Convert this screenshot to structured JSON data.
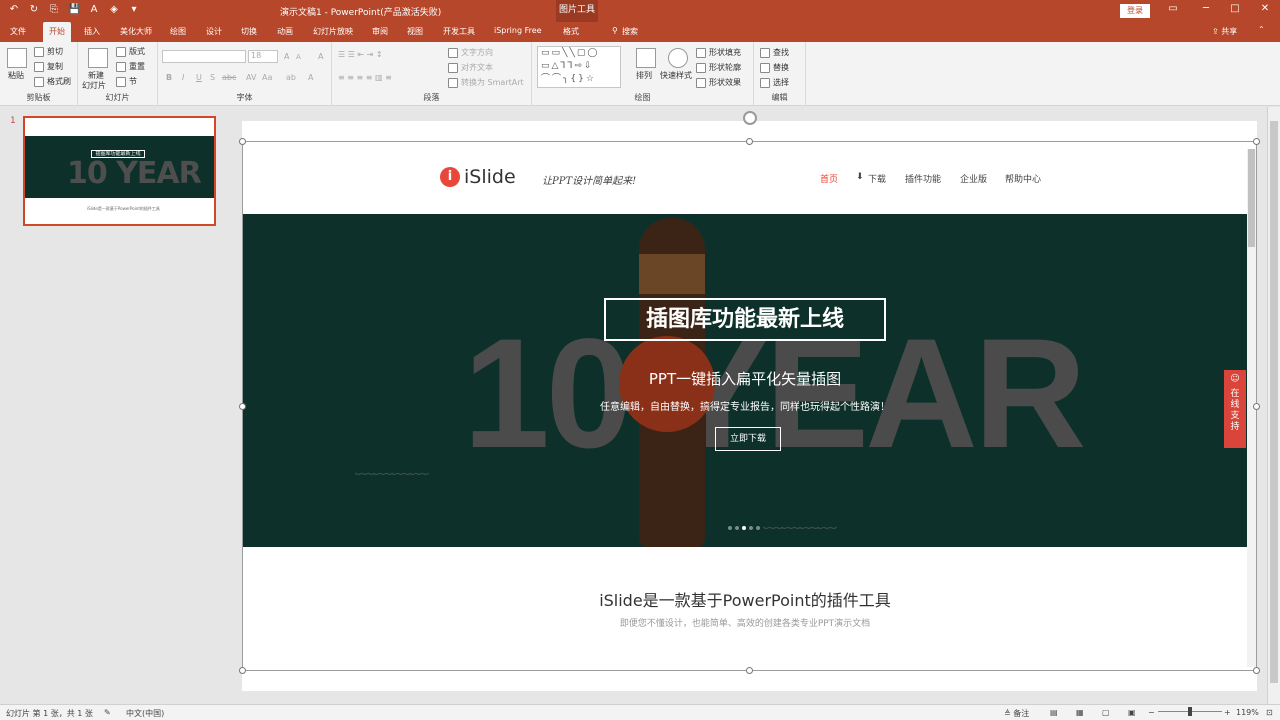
{
  "app": {
    "title": "演示文稿1  -  PowerPoint(产品激活失败)",
    "tool_context": "图片工具",
    "login": "登录",
    "share": "共享",
    "window_controls": [
      "▭",
      "─",
      "□",
      "✕"
    ]
  },
  "qat": [
    "↶",
    "↻",
    "⎘",
    "💾",
    "A",
    "◈",
    "▾"
  ],
  "tabs": [
    {
      "label": "文件"
    },
    {
      "label": "开始"
    },
    {
      "label": "插入"
    },
    {
      "label": "美化大师"
    },
    {
      "label": "绘图"
    },
    {
      "label": "设计"
    },
    {
      "label": "切换"
    },
    {
      "label": "动画"
    },
    {
      "label": "幻灯片放映"
    },
    {
      "label": "审阅"
    },
    {
      "label": "视图"
    },
    {
      "label": "开发工具"
    },
    {
      "label": "iSpring Free"
    },
    {
      "label": "格式"
    },
    {
      "label": "搜索"
    }
  ],
  "ribbon": {
    "clipboard": {
      "paste": "粘贴",
      "cut": "剪切",
      "copy": "复制",
      "format_painter": "格式刷",
      "group": "剪贴板"
    },
    "slides": {
      "new_slide_1": "新建",
      "new_slide_2": "幻灯片",
      "layout": "版式",
      "reset": "重置",
      "section": "节",
      "group": "幻灯片"
    },
    "font": {
      "size": "18",
      "group": "字体",
      "bold": "B",
      "italic": "I",
      "underline": "U",
      "strike": "S",
      "shadow": "abc",
      "grow": "A",
      "shrink": "A",
      "clear": "A",
      "spacing": "AV",
      "case": "Aa",
      "color": "A"
    },
    "paragraph": {
      "text_direction": "文字方向",
      "align_text": "对齐文本",
      "smartart": "转换为 SmartArt",
      "group": "段落"
    },
    "drawing": {
      "shapes_glyphs": "▭▭╲╲▢◯ ▭△⅂⅂⇨⇩ ⌒⌒╮{}☆",
      "arrange": "排列",
      "quick_styles": "快速样式",
      "fill": "形状填充",
      "outline": "形状轮廓",
      "effects": "形状效果",
      "group": "绘图"
    },
    "editing": {
      "find": "查找",
      "replace": "替换",
      "select": "选择",
      "group": "编辑"
    }
  },
  "slide_panel": {
    "number": "1",
    "thumb_headline": "插图库功能最新上线",
    "thumb_big": "10 YEAR",
    "thumb_intro": "iSlide是一款基于PowerPoint的插件工具"
  },
  "website": {
    "logo_letter": "i",
    "logo_text": "iSlide",
    "slogan": "让PPT设计简单起来!",
    "nav": [
      "首页",
      "下载",
      "插件功能",
      "企业版",
      "帮助中心"
    ],
    "download_icon": "⬇",
    "hero": {
      "big_text": "10 YEAR",
      "headline": "插图库功能最新上线",
      "subtitle": "PPT一键插入扁平化矢量插图",
      "desc": "任意编辑，自由替换，搞得定专业报告，同样也玩得起个性路演！",
      "button": "立即下载",
      "waves": "﹏﹏﹏﹏"
    },
    "intro_title": "iSlide是一款基于PowerPoint的插件工具",
    "intro_sub": "即便您不懂设计，也能简单、高效的创建各类专业PPT演示文档",
    "support": "在线支持",
    "support_icon": "☺"
  },
  "status": {
    "slide_info": "幻灯片 第 1 张，共 1 张",
    "language": "中文(中国)",
    "notes": "备注",
    "zoom": "119%",
    "zoom_minus": "−",
    "zoom_plus": "+"
  },
  "colors": {
    "brand": "#b7472a",
    "hero_bg": "#0d312a",
    "accent": "#e8473b"
  }
}
